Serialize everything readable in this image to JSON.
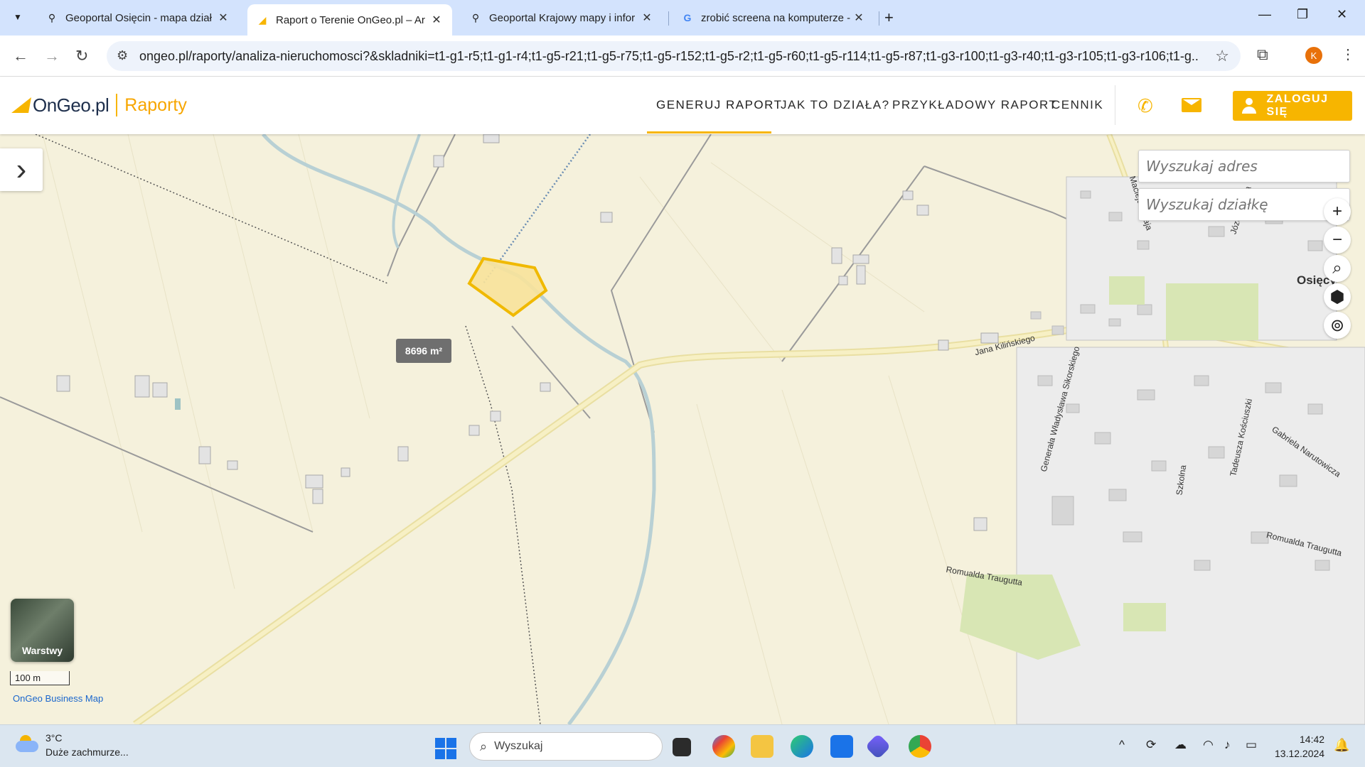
{
  "browser": {
    "tabs": [
      {
        "title": "Geoportal Osięcin - mapa dział",
        "favicon": "map-pin-icon",
        "active": false
      },
      {
        "title": "Raport o Terenie OnGeo.pl – Ar",
        "favicon": "ongeo-icon",
        "active": true
      },
      {
        "title": "Geoportal Krajowy mapy i infor",
        "favicon": "map-pin-icon",
        "active": false
      },
      {
        "title": "zrobić screena na komputerze -",
        "favicon": "google-icon",
        "active": false
      }
    ],
    "url": "ongeo.pl/raporty/analiza-nieruchomosci?&skladniki=t1-g1-r5;t1-g1-r4;t1-g5-r21;t1-g5-r75;t1-g5-r152;t1-g5-r2;t1-g5-r60;t1-g5-r114;t1-g5-r87;t1-g3-r100;t1-g3-r40;t1-g3-r105;t1-g3-r106;t1-g...",
    "profile_initial": "K"
  },
  "site": {
    "logo_name": "OnGeo.pl",
    "logo_product": "Raporty",
    "nav": [
      "GENERUJ RAPORT",
      "JAK TO DZIAŁA?",
      "PRZYKŁADOWY RAPORT",
      "CENNIK"
    ],
    "login_label": "ZALOGUJ SIĘ",
    "accent_color": "#f7b500"
  },
  "map": {
    "area_label": "8696 m²",
    "search_address_placeholder": "Wyszukaj adres",
    "search_parcel_placeholder": "Wyszukaj działkę",
    "zoom_in": "+",
    "zoom_out": "−",
    "layers_label": "Warstwy",
    "scale_label": "100 m",
    "attribution": "OnGeo Business Map",
    "place_label": "Osięcy",
    "streets": [
      "Jana Kilińskiego",
      "Macieja Rataja",
      "Józefa Bema",
      "Generała Władysława Sikorskiego",
      "Tadeusza Kościuszki",
      "Gabriela Narutowicza",
      "Romualda Traugutta",
      "Szkolna",
      "Romualda Traugutta"
    ]
  },
  "taskbar": {
    "temperature": "3°C",
    "weather": "Duże zachmurze...",
    "search_placeholder": "Wyszukaj",
    "time": "14:42",
    "date": "13.12.2024"
  }
}
